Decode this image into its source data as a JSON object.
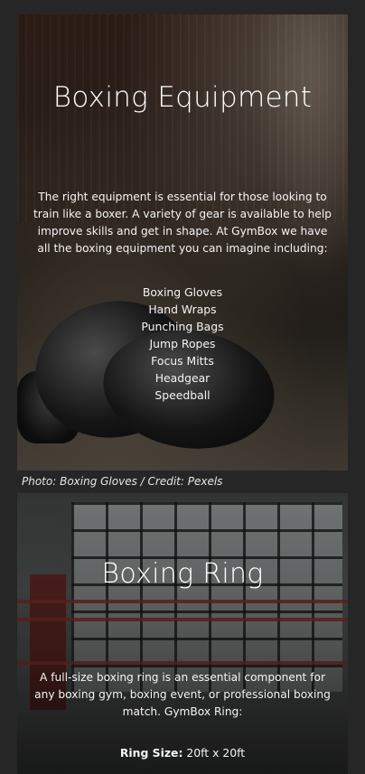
{
  "equipment_section": {
    "title": "Boxing Equipment",
    "description": "The right equipment is essential for those looking to train like a boxer. A variety of gear is available to help improve skills and get in shape. At GymBox we have all the boxing equipment you can imagine including:",
    "items": [
      "Boxing Gloves",
      "Hand Wraps",
      "Punching Bags",
      "Jump Ropes",
      "Focus Mitts",
      "Headgear",
      "Speedball"
    ],
    "photo_caption": "Photo: Boxing Gloves / Credit: Pexels"
  },
  "ring_section": {
    "title": "Boxing Ring",
    "description": "A full-size boxing ring is an essential component for any boxing gym, boxing event, or professional boxing match. GymBox Ring:",
    "size_label": "Ring Size:",
    "size_value": " 20ft x 20ft"
  },
  "colors": {
    "page_background": "#262626",
    "text": "#f4f4f4"
  }
}
